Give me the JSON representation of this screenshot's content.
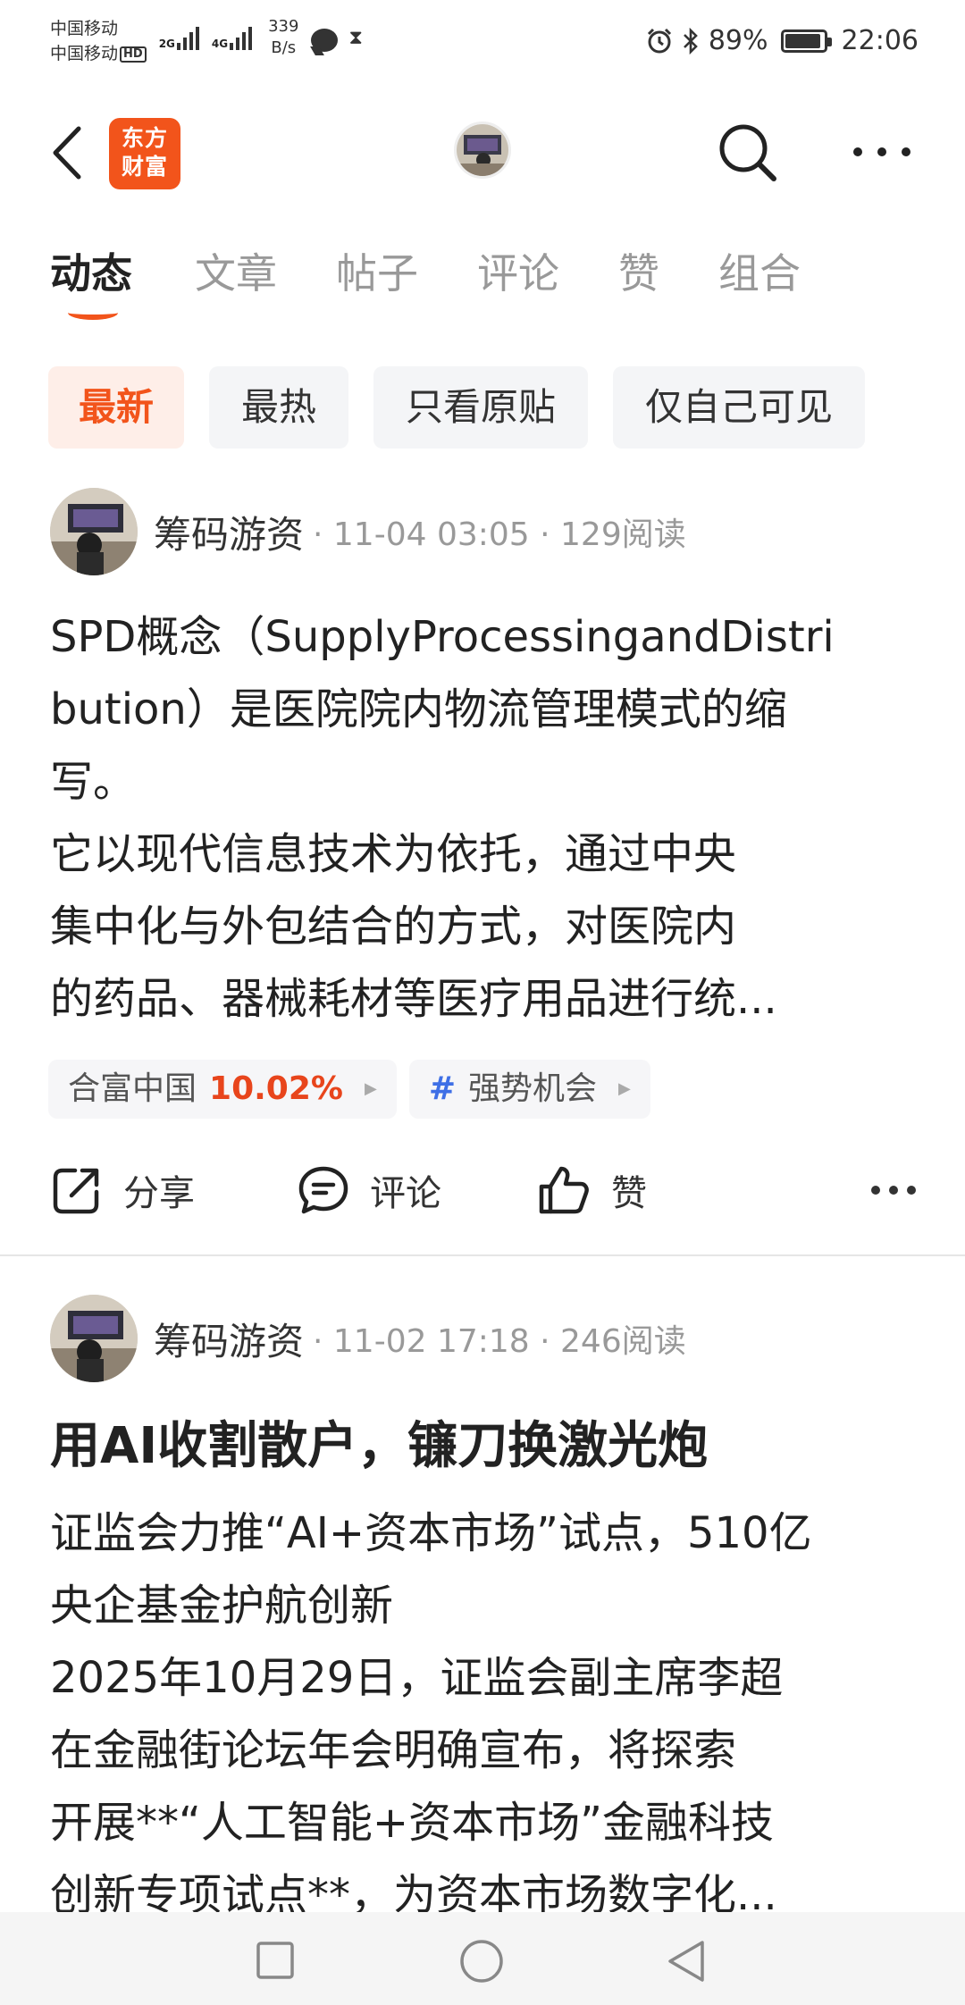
{
  "status_bar": {
    "carrier_1": "中国移动",
    "carrier_2": "中国移动",
    "hd": "HD",
    "net_1": "2G",
    "net_2": "4G",
    "speed_value": "339",
    "speed_unit": "B/s",
    "battery_pct": "89%",
    "time": "22:06",
    "icons": [
      "chat-bubble-icon",
      "hourglass-icon",
      "alarm-icon",
      "bluetooth-icon",
      "battery-icon"
    ]
  },
  "header": {
    "logo_line1": "东方",
    "logo_line2": "财富",
    "icons": [
      "back-arrow-icon",
      "search-icon",
      "more-icon"
    ]
  },
  "tabs": [
    {
      "label": "动态",
      "active": true
    },
    {
      "label": "文章",
      "active": false
    },
    {
      "label": "帖子",
      "active": false
    },
    {
      "label": "评论",
      "active": false
    },
    {
      "label": "赞",
      "active": false
    },
    {
      "label": "组合",
      "active": false
    }
  ],
  "filters": [
    {
      "label": "最新",
      "active": true
    },
    {
      "label": "最热",
      "active": false
    },
    {
      "label": "只看原贴",
      "active": false
    },
    {
      "label": "仅自己可见",
      "active": false
    }
  ],
  "posts": [
    {
      "author": "筹码游资",
      "meta": "· 11-04 03:05 · 129阅读",
      "lines": [
        "SPD概念（SupplyProcessingandDistri",
        "bution）是医院院内物流管理模式的缩",
        "写。",
        "它以现代信息技术为依托，通过中央",
        "集中化与外包结合的方式，对医院内",
        "的药品、器械耗材等医疗用品进行统..."
      ],
      "tag_stock_name": "合富中国",
      "tag_stock_pct": "10.02%",
      "tag_topic": "强势机会",
      "actions": {
        "share": "分享",
        "comment": "评论",
        "like": "赞"
      }
    },
    {
      "author": "筹码游资",
      "meta": "· 11-02 17:18 · 246阅读",
      "title": "用AI收割散户，镰刀换激光炮",
      "lines": [
        "证监会力推“AI+资本市场”试点，510亿",
        "央企基金护航创新",
        "2025年10月29日，证监会副主席李超",
        "在金融街论坛年会明确宣布，将探索",
        "开展**“人工智能+资本市场”金融科技",
        "创新专项试点**，为资本市场数字化..."
      ]
    }
  ],
  "colors": {
    "accent": "#f2541b",
    "stock_up": "#e8451c",
    "topic_hash": "#3e6fe6"
  },
  "nav_bar": {
    "icons": [
      "square-recents-icon",
      "circle-home-icon",
      "triangle-back-icon"
    ]
  }
}
